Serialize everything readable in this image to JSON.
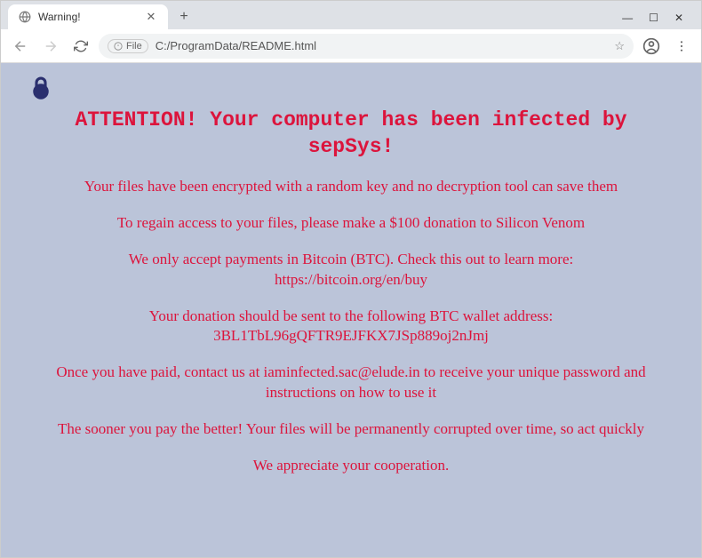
{
  "window": {
    "tab_title": "Warning!",
    "new_tab_glyph": "+",
    "minimize_glyph": "—",
    "maximize_glyph": "☐",
    "close_glyph": "✕"
  },
  "addressbar": {
    "file_label": "File",
    "url": "C:/ProgramData/README.html"
  },
  "page": {
    "title": "ATTENTION! Your computer has been infected by sepSys!",
    "p1": "Your files have been encrypted with a random key and no decryption tool can save them",
    "p2": "To regain access to your files, please make a $100 donation to Silicon Venom",
    "p3a": "We only accept payments in Bitcoin (BTC). Check this out to learn more:",
    "p3b": "https://bitcoin.org/en/buy",
    "p4a": "Your donation should be sent to the following BTC wallet address:",
    "p4b": "3BL1TbL96gQFTR9EJFKX7JSp889oj2nJmj",
    "p5": "Once you have paid, contact us at iaminfected.sac@elude.in to receive your unique password and instructions on how to use it",
    "p6": "The sooner you pay the better! Your files will be permanently corrupted over time, so act quickly",
    "p7": "We appreciate your cooperation."
  }
}
